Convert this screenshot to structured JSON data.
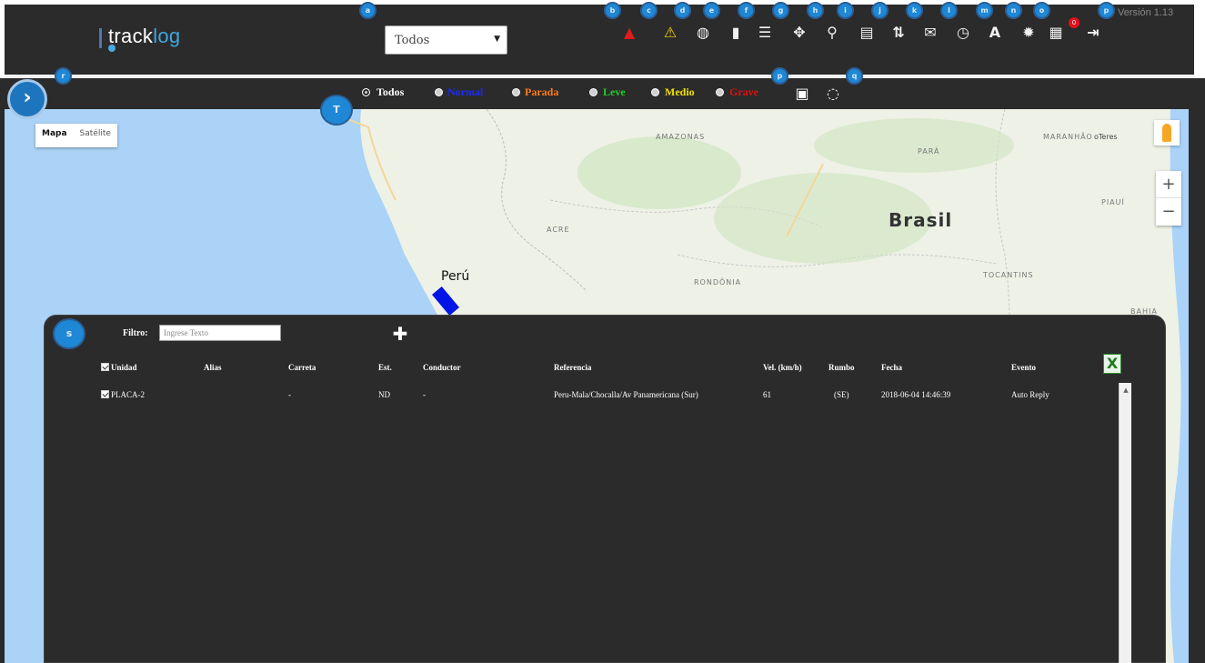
{
  "header": {
    "logo_prefix": "track",
    "logo_suffix": "log",
    "version": "Versión 1.13",
    "unit_select": {
      "value": "Todos"
    },
    "notification_count": "0",
    "tool_markers": [
      "a",
      "b",
      "c",
      "d",
      "e",
      "f",
      "g",
      "h",
      "i",
      "j",
      "k",
      "l",
      "m",
      "n",
      "o",
      "p"
    ],
    "tools": [
      {
        "icon": "alarm-bell-icon",
        "glyph": "▲",
        "color": "red"
      },
      {
        "icon": "warning-icon",
        "glyph": "⚠",
        "color": "yellow"
      },
      {
        "icon": "globe-icon",
        "glyph": "◍",
        "color": "white"
      },
      {
        "icon": "document-icon",
        "glyph": "▮",
        "color": "white"
      },
      {
        "icon": "list-report-icon",
        "glyph": "☰",
        "color": "white"
      },
      {
        "icon": "route-icon",
        "glyph": "✥",
        "color": "white"
      },
      {
        "icon": "location-pin-icon",
        "glyph": "⚲",
        "color": "white"
      },
      {
        "icon": "file-list-icon",
        "glyph": "▤",
        "color": "white"
      },
      {
        "icon": "sort-updown-icon",
        "glyph": "⇅",
        "color": "white"
      },
      {
        "icon": "mail-icon",
        "glyph": "✉",
        "color": "white"
      },
      {
        "icon": "clock-icon",
        "glyph": "◷",
        "color": "white"
      },
      {
        "icon": "font-icon",
        "glyph": "A",
        "color": "white"
      },
      {
        "icon": "gear-icon",
        "glyph": "✹",
        "color": "white"
      },
      {
        "icon": "grid-icon",
        "glyph": "▦",
        "color": "white"
      },
      {
        "icon": "logout-icon",
        "glyph": "⇥",
        "color": "white"
      }
    ]
  },
  "filterbar": {
    "options": [
      {
        "label": "Todos",
        "color": "#ffffff",
        "checked": true
      },
      {
        "label": "Normal",
        "color": "#1a2cff",
        "checked": false
      },
      {
        "label": "Parada",
        "color": "#ff7a1a",
        "checked": false
      },
      {
        "label": "Leve",
        "color": "#22d022",
        "checked": false
      },
      {
        "label": "Medio",
        "color": "#f0e000",
        "checked": false
      },
      {
        "label": "Grave",
        "color": "#e01010",
        "checked": false
      }
    ]
  },
  "map": {
    "type_control": {
      "map": "Mapa",
      "satellite": "Satélite"
    },
    "labels": {
      "amazonas": "AMAZONAS",
      "para": "PARÁ",
      "maranhao": "MARANHÃO",
      "acre": "ACRE",
      "brasil": "Brasil",
      "piaui": "PIAUÍ",
      "peru": "Perú",
      "rondonia": "RONDÔNIA",
      "tocantins": "TOCANTINS",
      "bahia": "BAHIA",
      "teresina_partial": "oTeres"
    },
    "zoom": {
      "in": "+",
      "out": "−"
    }
  },
  "panel": {
    "filter_label": "Filtro:",
    "filter_placeholder": "Ingrese Texto",
    "columns": [
      "Unidad",
      "Alias",
      "Carreta",
      "Est.",
      "Conductor",
      "Referencia",
      "Vel. (km/h)",
      "Rumbo",
      "Fecha",
      "Evento"
    ],
    "rows": [
      {
        "unidad": "PLACA-2",
        "alias": "",
        "carreta": "-",
        "est": "ND",
        "conductor": "-",
        "referencia": "Peru-Mala/Chocalla/Av Panamericana (Sur)",
        "vel": "61",
        "rumbo": "(SE)",
        "fecha": "2018-06-04 14:46:39",
        "evento": "Auto Reply"
      }
    ]
  },
  "markers": {
    "filterbar_left": "r",
    "panel": "s",
    "map": "T",
    "filterbar_a": "p",
    "filterbar_b": "q"
  }
}
